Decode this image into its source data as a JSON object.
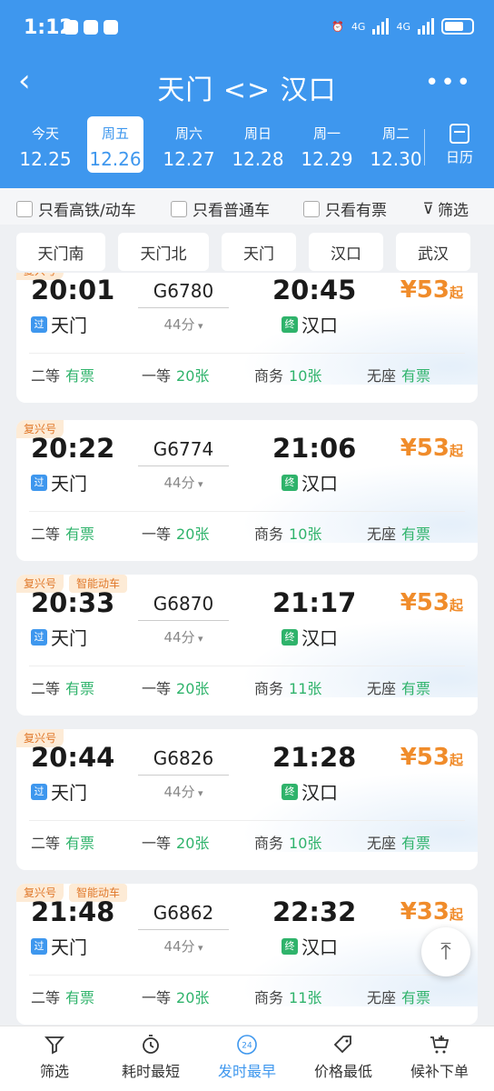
{
  "status_bar": {
    "time": "1:12",
    "net1": "4G",
    "net2": "4G"
  },
  "header": {
    "title": "天门 <> 汉口",
    "dates": [
      {
        "dow": "今天",
        "date": "12.25",
        "selected": false
      },
      {
        "dow": "周五",
        "date": "12.26",
        "selected": true
      },
      {
        "dow": "周六",
        "date": "12.27",
        "selected": false
      },
      {
        "dow": "周日",
        "date": "12.28",
        "selected": false
      },
      {
        "dow": "周一",
        "date": "12.29",
        "selected": false
      },
      {
        "dow": "周二",
        "date": "12.30",
        "selected": false
      }
    ],
    "calendar_label": "日历"
  },
  "filters": {
    "high_speed": "只看高铁/动车",
    "normal": "只看普通车",
    "available": "只看有票",
    "filter": "筛选"
  },
  "stations": [
    "天门南",
    "天门北",
    "天门",
    "汉口",
    "武汉"
  ],
  "trains": [
    {
      "badges": [
        "复兴号"
      ],
      "dep": "20:01",
      "no": "G6780",
      "dur": "44分",
      "arr": "20:45",
      "from": "天门",
      "to": "汉口",
      "from_tag": "过",
      "to_tag": "终",
      "price": "¥53",
      "price_suffix": "起",
      "seats": [
        {
          "name": "二等",
          "val": "有票"
        },
        {
          "name": "一等",
          "val": "20张"
        },
        {
          "name": "商务",
          "val": "10张"
        },
        {
          "name": "无座",
          "val": "有票"
        }
      ]
    },
    {
      "badges": [
        "复兴号"
      ],
      "dep": "20:22",
      "no": "G6774",
      "dur": "44分",
      "arr": "21:06",
      "from": "天门",
      "to": "汉口",
      "from_tag": "过",
      "to_tag": "终",
      "price": "¥53",
      "price_suffix": "起",
      "seats": [
        {
          "name": "二等",
          "val": "有票"
        },
        {
          "name": "一等",
          "val": "20张"
        },
        {
          "name": "商务",
          "val": "10张"
        },
        {
          "name": "无座",
          "val": "有票"
        }
      ]
    },
    {
      "badges": [
        "复兴号",
        "智能动车"
      ],
      "dep": "20:33",
      "no": "G6870",
      "dur": "44分",
      "arr": "21:17",
      "from": "天门",
      "to": "汉口",
      "from_tag": "过",
      "to_tag": "终",
      "price": "¥53",
      "price_suffix": "起",
      "seats": [
        {
          "name": "二等",
          "val": "有票"
        },
        {
          "name": "一等",
          "val": "20张"
        },
        {
          "name": "商务",
          "val": "11张"
        },
        {
          "name": "无座",
          "val": "有票"
        }
      ]
    },
    {
      "badges": [
        "复兴号"
      ],
      "dep": "20:44",
      "no": "G6826",
      "dur": "44分",
      "arr": "21:28",
      "from": "天门",
      "to": "汉口",
      "from_tag": "过",
      "to_tag": "终",
      "price": "¥53",
      "price_suffix": "起",
      "seats": [
        {
          "name": "二等",
          "val": "有票"
        },
        {
          "name": "一等",
          "val": "20张"
        },
        {
          "name": "商务",
          "val": "10张"
        },
        {
          "name": "无座",
          "val": "有票"
        }
      ]
    },
    {
      "badges": [
        "复兴号",
        "智能动车"
      ],
      "dep": "21:48",
      "no": "G6862",
      "dur": "44分",
      "arr": "22:32",
      "from": "天门",
      "to": "汉口",
      "from_tag": "过",
      "to_tag": "终",
      "price": "¥33",
      "price_suffix": "起",
      "seats": [
        {
          "name": "二等",
          "val": "有票"
        },
        {
          "name": "一等",
          "val": "20张"
        },
        {
          "name": "商务",
          "val": "11张"
        },
        {
          "name": "无座",
          "val": "有票"
        }
      ]
    }
  ],
  "bottom_nav": [
    {
      "label": "筛选",
      "icon": "funnel-icon",
      "active": false
    },
    {
      "label": "耗时最短",
      "icon": "timer-icon",
      "active": false
    },
    {
      "label": "发时最早",
      "icon": "clock-24-icon",
      "active": true
    },
    {
      "label": "价格最低",
      "icon": "price-tag-icon",
      "active": false
    },
    {
      "label": "候补下单",
      "icon": "cart-plus-icon",
      "active": false
    }
  ],
  "colors": {
    "brand": "#3e97ee",
    "price": "#f08c2b",
    "available": "#2fb36b"
  }
}
